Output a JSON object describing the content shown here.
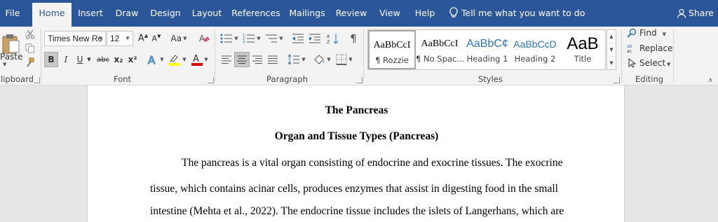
{
  "tabs": [
    "File",
    "Home",
    "Insert",
    "Draw",
    "Design",
    "Layout",
    "References",
    "Mailings",
    "Review",
    "View",
    "Help"
  ],
  "active_tab": "Home",
  "tell_me": "Tell me what you want to do",
  "share": "Share",
  "clipboard": {
    "paste_label": "Paste",
    "group_label": "Clipboard"
  },
  "font": {
    "name": "Times New Ro",
    "size": "12",
    "group_label": "Font",
    "case_label": "Aa",
    "bold": "B",
    "italic": "I",
    "underline": "U",
    "strike": "abc",
    "subscript": "x₂",
    "superscript": "x²"
  },
  "paragraph": {
    "group_label": "Paragraph",
    "pilcrow": "¶"
  },
  "styles": {
    "group_label": "Styles",
    "items": [
      {
        "sample": "AaBbCcI",
        "name": "¶ Rozzie"
      },
      {
        "sample": "AaBbCcI",
        "name": "¶ No Spac..."
      },
      {
        "sample": "AaBbC¢",
        "name": "Heading 1"
      },
      {
        "sample": "AaBbCcD",
        "name": "Heading 2"
      },
      {
        "sample": "AaB",
        "name": "Title"
      }
    ]
  },
  "editing": {
    "group_label": "Editing",
    "find": "Find",
    "replace": "Replace",
    "select": "Select"
  },
  "document": {
    "title": "The Pancreas",
    "heading": "Organ and Tissue Types (Pancreas)",
    "lines": [
      "The pancreas is a vital organ consisting of endocrine and exocrine tissues. The exocrine",
      "tissue, which contains acinar cells, produces enzymes that assist in digesting food in the small",
      "intestine (Mehta et al., 2022). The endocrine tissue includes the islets of Langerhans, which are"
    ]
  },
  "colors": {
    "title_bar": "#2b579a",
    "ribbon": "#f3f3f3",
    "heading_style": "#2e74b5",
    "font_color_bar": "#e00000",
    "highlight_bar": "#ffff00"
  }
}
